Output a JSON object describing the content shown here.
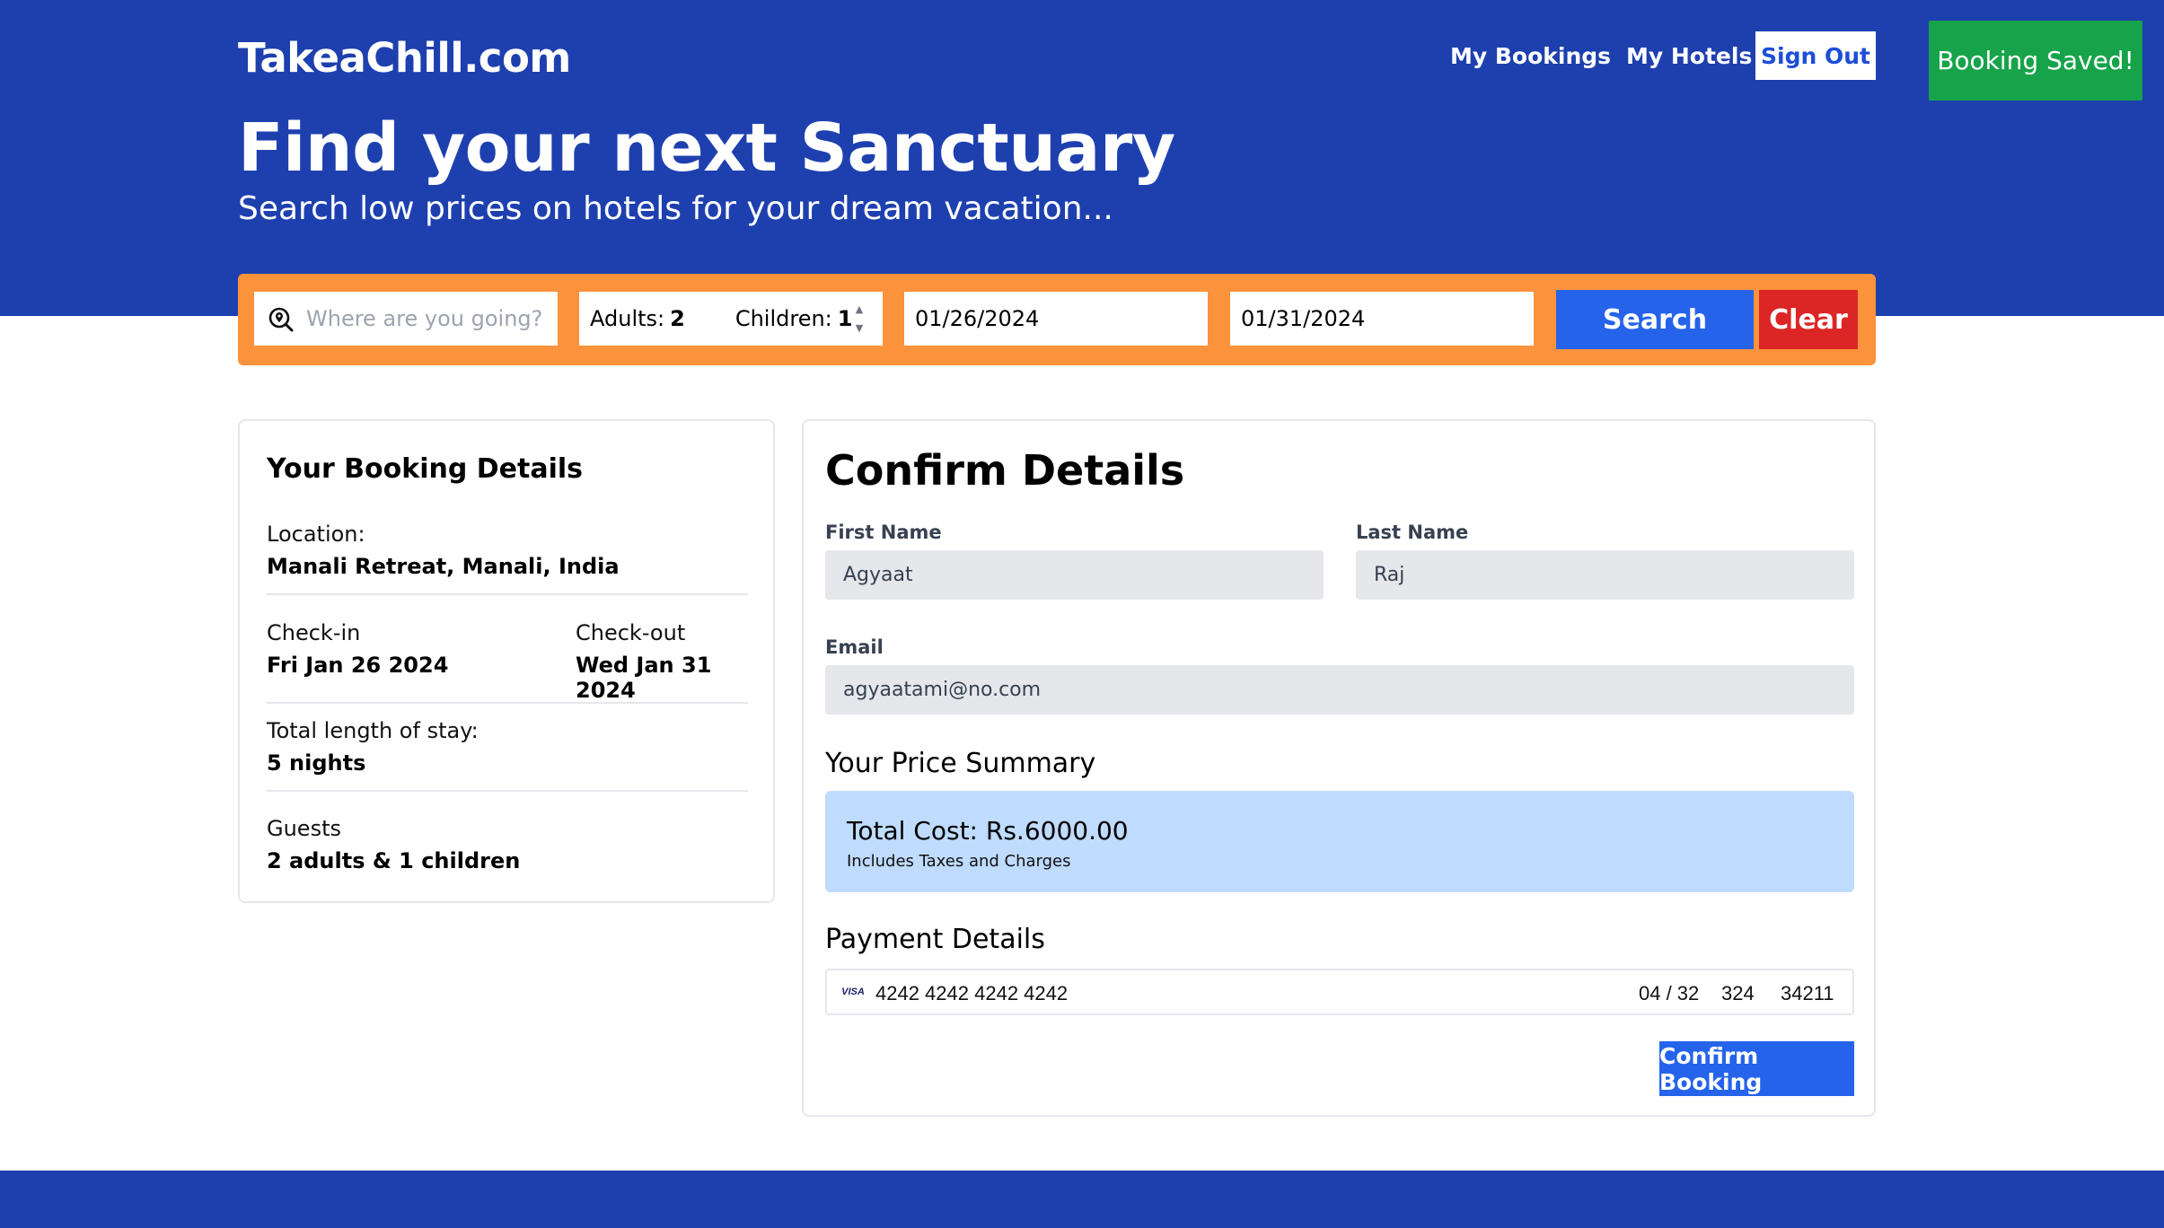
{
  "header": {
    "logo": "TakeaChill.com",
    "nav": {
      "my_bookings": "My Bookings",
      "my_hotels": "My Hotels",
      "sign_out": "Sign Out"
    },
    "toast": "Booking Saved!"
  },
  "hero": {
    "title": "Find your next Sanctuary",
    "subtitle": "Search low prices on hotels for your dream vacation..."
  },
  "search": {
    "destination_placeholder": "Where are you going?",
    "destination_icon": "search-location-icon",
    "adults_label": "Adults:",
    "adults_value": "2",
    "children_label": "Children:",
    "children_value": "1",
    "check_in": "01/26/2024",
    "check_out": "01/31/2024",
    "search_label": "Search",
    "clear_label": "Clear"
  },
  "booking_details": {
    "title": "Your Booking Details",
    "location_label": "Location:",
    "location_value": "Manali Retreat, Manali, India",
    "checkin_label": "Check-in",
    "checkin_value": "Fri Jan 26 2024",
    "checkout_label": "Check-out",
    "checkout_value": "Wed Jan 31 2024",
    "stay_label": "Total length of stay:",
    "stay_value": "5 nights",
    "guests_label": "Guests",
    "guests_value": "2 adults & 1 children"
  },
  "confirm": {
    "title": "Confirm Details",
    "first_name_label": "First Name",
    "first_name_value": "Agyaat",
    "last_name_label": "Last Name",
    "last_name_value": "Raj",
    "email_label": "Email",
    "email_value": "agyaatami@no.com",
    "price_summary_title": "Your Price Summary",
    "total_cost": "Total Cost: Rs.6000.00",
    "price_note": "Includes Taxes and Charges",
    "payment_title": "Payment Details",
    "card_brand": "VISA",
    "card_number": "4242 4242 4242 4242",
    "card_expiry": "04 / 32",
    "card_cvc": "324",
    "card_zip": "34211",
    "confirm_button": "Confirm Booking"
  },
  "colors": {
    "primary": "#1e40af",
    "search_bar": "#fb923c",
    "button_blue": "#2563eb",
    "button_red": "#dc2626",
    "toast_green": "#16a34a",
    "price_box": "#bfdbfe"
  }
}
